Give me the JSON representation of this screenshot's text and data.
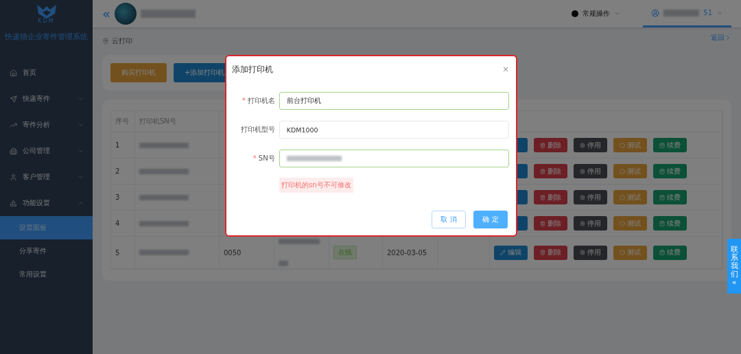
{
  "sidebar": {
    "logo_text": "KDM",
    "title": "快递猫企业寄件管理系统",
    "items": [
      {
        "label": "首页"
      },
      {
        "label": "快递寄件",
        "expanded": false
      },
      {
        "label": "寄件分析",
        "expanded": false
      },
      {
        "label": "公司管理",
        "expanded": false
      },
      {
        "label": "客户管理",
        "expanded": false
      },
      {
        "label": "功能设置",
        "expanded": true,
        "children": [
          {
            "label": "设置面板",
            "selected": true
          },
          {
            "label": "分享寄件",
            "selected": false
          },
          {
            "label": "常用设置",
            "selected": false
          }
        ]
      }
    ]
  },
  "header": {
    "collapse": "«",
    "menu": "常规操作",
    "user_suffix": "51"
  },
  "breadcrumb": {
    "current": "云打印",
    "back": "返回"
  },
  "toolbar": {
    "buttons": [
      {
        "label": "购买打印机",
        "kind": "warning"
      },
      {
        "label": "+添加打印机",
        "kind": "primary"
      }
    ]
  },
  "table": {
    "columns": [
      "序号",
      "打印机SN号"
    ],
    "rows": [
      {
        "index": "1",
        "actions": [
          {
            "kind": "edit"
          },
          {
            "label": "删除",
            "kind": "delete"
          },
          {
            "label": "停用",
            "kind": "disable"
          },
          {
            "label": "测试",
            "kind": "test"
          },
          {
            "label": "续费",
            "kind": "renew"
          }
        ]
      },
      {
        "index": "2",
        "actions": [
          {
            "kind": "edit"
          },
          {
            "label": "删除",
            "kind": "delete"
          },
          {
            "label": "停用",
            "kind": "disable"
          },
          {
            "label": "测试",
            "kind": "test"
          },
          {
            "label": "续费",
            "kind": "renew"
          }
        ]
      },
      {
        "index": "3",
        "actions": [
          {
            "kind": "edit"
          },
          {
            "label": "删除",
            "kind": "delete"
          },
          {
            "label": "停用",
            "kind": "disable"
          },
          {
            "label": "测试",
            "kind": "test"
          },
          {
            "label": "续费",
            "kind": "renew"
          }
        ]
      },
      {
        "index": "4",
        "actions": [
          {
            "kind": "edit"
          },
          {
            "label": "删除",
            "kind": "delete"
          },
          {
            "label": "停用",
            "kind": "disable"
          },
          {
            "label": "测试",
            "kind": "test"
          },
          {
            "label": "续费",
            "kind": "renew"
          }
        ]
      },
      {
        "index": "5",
        "column_3": "0050",
        "status": "在线",
        "date": "2020-03-05",
        "actions": [
          {
            "label": "编辑",
            "kind": "edit"
          },
          {
            "label": "删除",
            "kind": "delete"
          },
          {
            "label": "停用",
            "kind": "disable"
          },
          {
            "label": "测试",
            "kind": "test"
          },
          {
            "label": "续费",
            "kind": "renew"
          }
        ]
      }
    ]
  },
  "dialog": {
    "title": "添加打印机",
    "close": "×",
    "fields": [
      {
        "required_mark": "*",
        "label": "打印机名",
        "value": "前台打印机",
        "valid": true
      },
      {
        "label": "打印机型号",
        "value": "KDM1000",
        "valid": false
      },
      {
        "required_mark": "*",
        "label": "SN号",
        "valid": true
      }
    ],
    "hint": "打印机的sn号不可修改",
    "buttons": [
      {
        "label": "取 消",
        "kind": "default"
      },
      {
        "label": "确 定",
        "kind": "primary"
      }
    ]
  },
  "contact_tab": {
    "chars": [
      "联",
      "系",
      "我",
      "们"
    ],
    "collapse": "«"
  }
}
